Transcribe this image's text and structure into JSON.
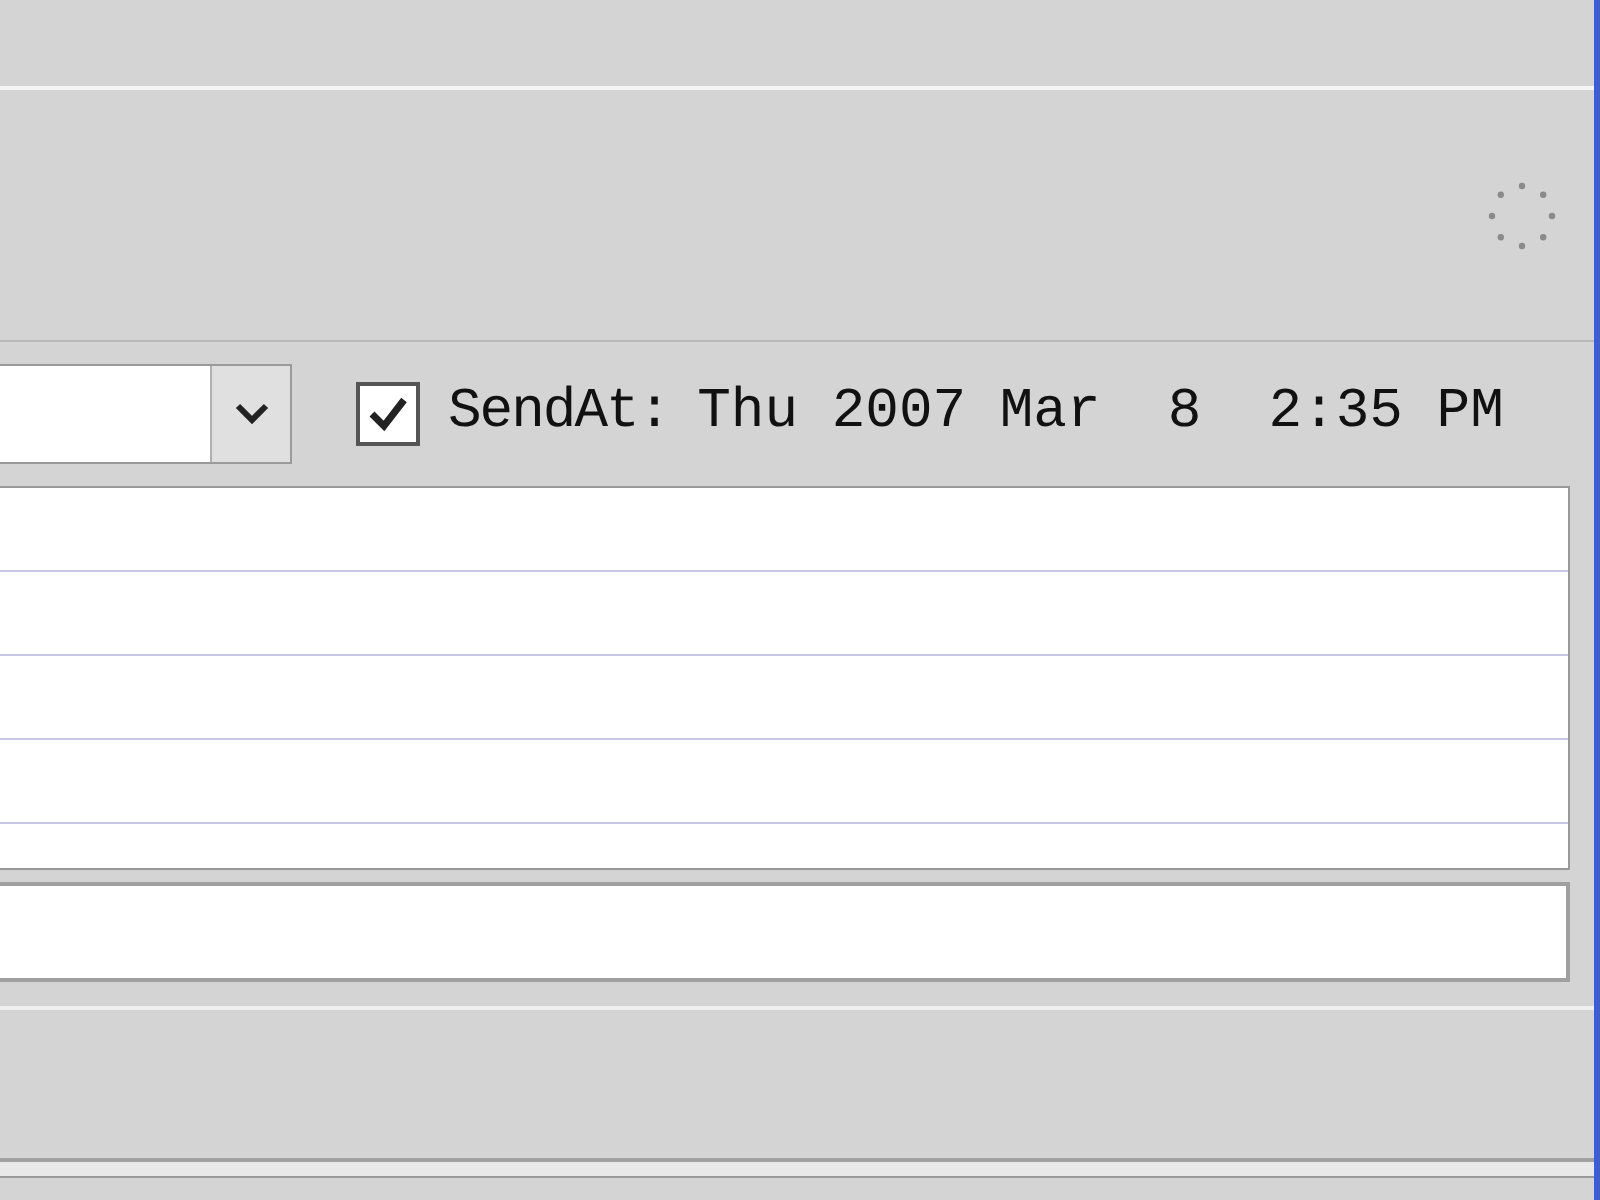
{
  "send_at": {
    "checked": true,
    "label": "SendAt:",
    "value": "Thu 2007 Mar  8  2:35 PM"
  }
}
